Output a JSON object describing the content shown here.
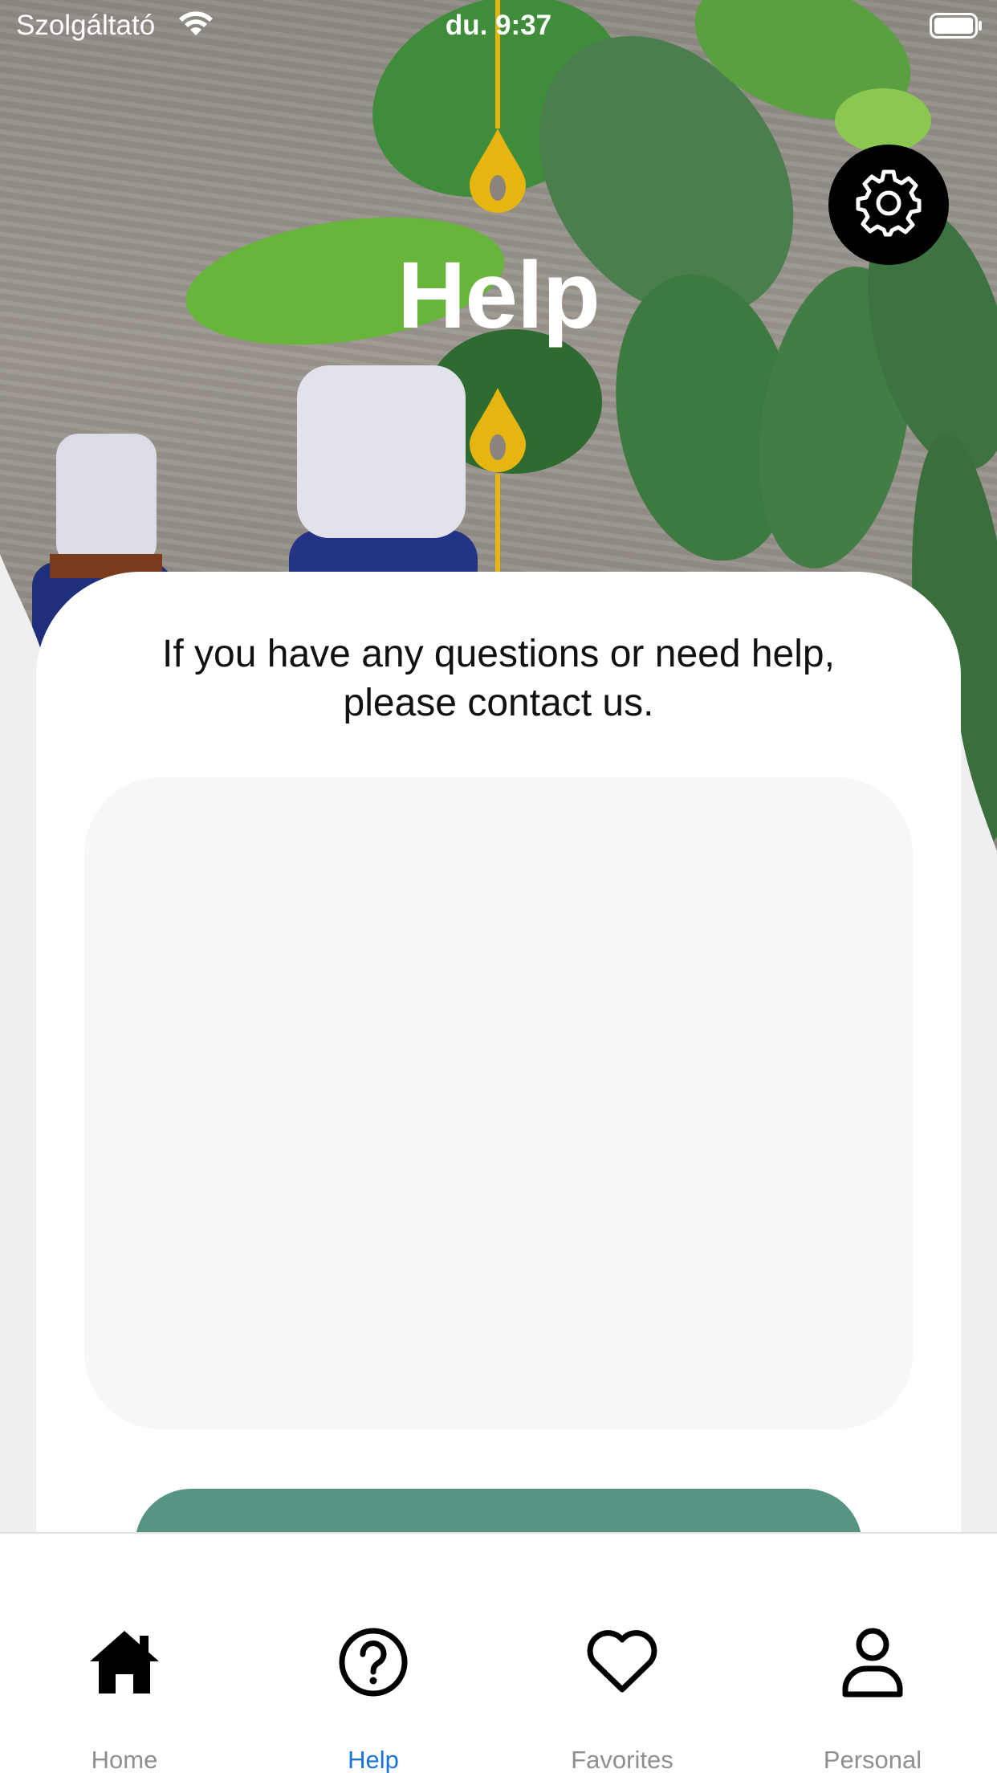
{
  "status_bar": {
    "carrier": "Szolgáltató",
    "time": "du. 9:37"
  },
  "header": {
    "title": "Help",
    "settings_icon": "gear-icon"
  },
  "help_card": {
    "message": "If you have any questions or need help,\nplease contact us.",
    "message_box_placeholder": "",
    "send_button_label": ""
  },
  "tab_bar": {
    "tabs": [
      {
        "label": "Home",
        "icon": "home-icon",
        "active": false
      },
      {
        "label": "Help",
        "icon": "question-circle-icon",
        "active": true
      },
      {
        "label": "Favorites",
        "icon": "heart-icon",
        "active": false
      },
      {
        "label": "Personal",
        "icon": "person-icon",
        "active": false
      }
    ]
  },
  "colors": {
    "accent": "#1a73d9",
    "send_button": "#579484",
    "drop_accent": "#e6b512",
    "inactive_tab": "#8e8e93"
  }
}
